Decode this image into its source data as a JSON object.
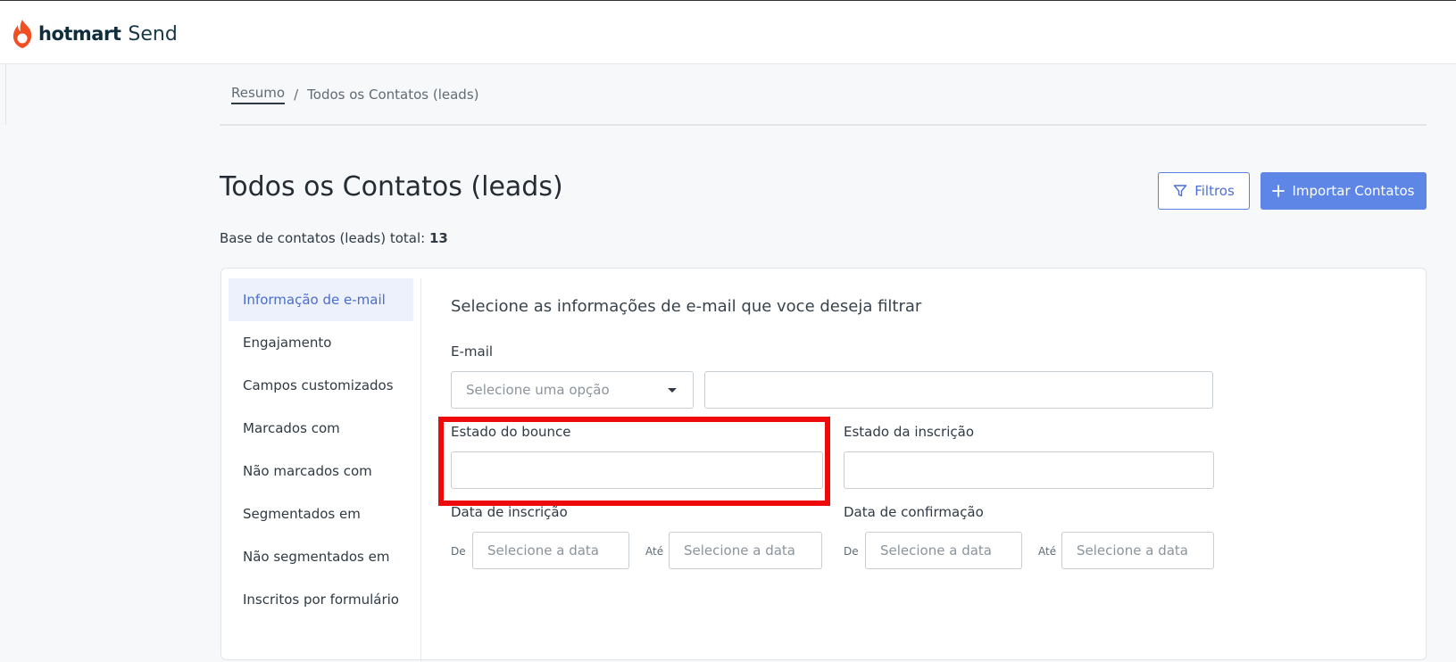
{
  "brand": {
    "name": "hotmart",
    "product": "Send",
    "accent": "#f04e23"
  },
  "breadcrumb": {
    "home": "Resumo",
    "separator": "/",
    "current": "Todos os Contatos (leads)"
  },
  "page": {
    "title": "Todos os Contatos (leads)",
    "total_label": "Base de contatos (leads) total:",
    "total_value": "13"
  },
  "actions": {
    "filters_label": "Filtros",
    "filters_icon": "filter-icon",
    "import_label": "Importar Contatos",
    "import_icon": "plus-icon",
    "primary_color": "#5d86e6"
  },
  "sidebar": {
    "items": [
      {
        "label": "Informação de e-mail",
        "active": true
      },
      {
        "label": "Engajamento",
        "active": false
      },
      {
        "label": "Campos customizados",
        "active": false
      },
      {
        "label": "Marcados com",
        "active": false
      },
      {
        "label": "Não marcados com",
        "active": false
      },
      {
        "label": "Segmentados em",
        "active": false
      },
      {
        "label": "Não segmentados em",
        "active": false
      },
      {
        "label": "Inscritos por formulário",
        "active": false
      }
    ]
  },
  "filters": {
    "heading": "Selecione as informações de e-mail que voce deseja filtrar",
    "email": {
      "label": "E-mail",
      "select_placeholder": "Selecione uma opção",
      "value": ""
    },
    "bounce": {
      "label": "Estado do bounce",
      "value": ""
    },
    "subscription_state": {
      "label": "Estado da inscrição",
      "value": ""
    },
    "subscription_date": {
      "label": "Data de inscrição",
      "from_label": "De",
      "to_label": "Até",
      "from_placeholder": "Selecione a data",
      "to_placeholder": "Selecione a data"
    },
    "confirmation_date": {
      "label": "Data de confirmação",
      "from_label": "De",
      "to_label": "Até",
      "from_placeholder": "Selecione a data",
      "to_placeholder": "Selecione a data"
    }
  },
  "annotation": {
    "highlight_color": "#ee0a0a",
    "target": "bounce"
  }
}
